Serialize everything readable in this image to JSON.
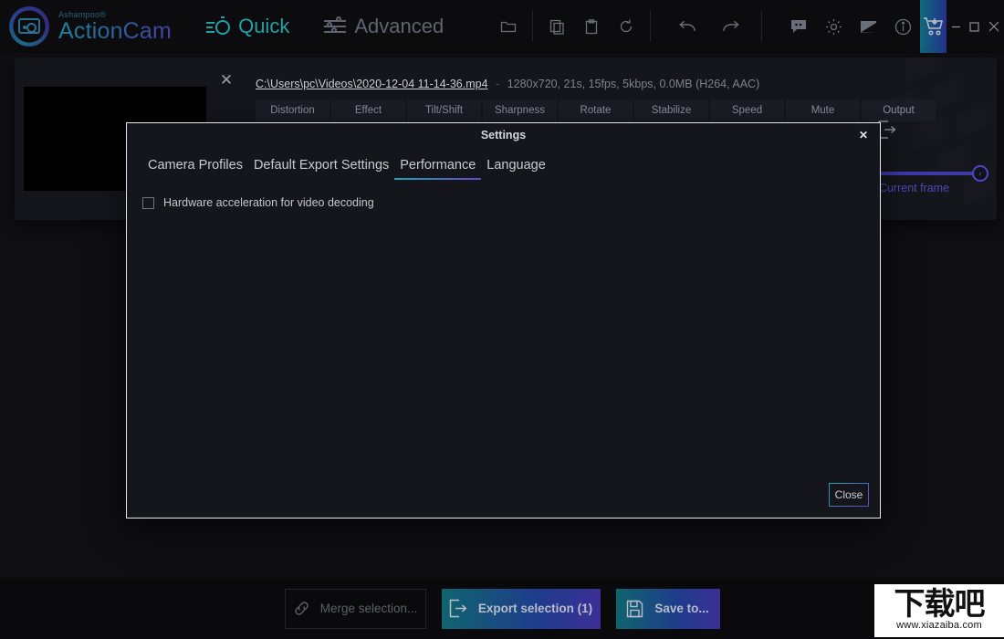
{
  "app": {
    "brand_sup": "Ashampoo®",
    "brand_name": "ActionCam",
    "accent_teal": "#1ba6b0",
    "accent_purple": "#6b43c9"
  },
  "titlebar": {
    "modes": [
      {
        "label": "Quick",
        "icon": "stopwatch-icon",
        "active": true
      },
      {
        "label": "Advanced",
        "icon": "sliders-icon",
        "active": false
      }
    ],
    "tools": [
      {
        "name": "open-folder-icon"
      },
      {
        "name": "copy-icon"
      },
      {
        "name": "paste-icon"
      },
      {
        "name": "reset-icon"
      },
      {
        "name": "undo-icon"
      },
      {
        "name": "redo-icon"
      },
      {
        "name": "feedback-icon"
      },
      {
        "name": "settings-gear-icon"
      },
      {
        "name": "theme-icon"
      },
      {
        "name": "info-icon"
      }
    ],
    "buy_icon": "cart-download-icon",
    "window_controls": {
      "minimize": "–",
      "maximize": "□",
      "close": "✕"
    }
  },
  "clip": {
    "close_glyph": "✕",
    "path": "C:\\Users\\pc\\Videos\\2020-12-04 11-14-36.mp4",
    "dash": "-",
    "info": "1280x720, 21s, 15fps, 5kbps, 0.0MB (H264, AAC)",
    "edit_tabs": [
      "Distortion",
      "Effect",
      "Tilt/Shift",
      "Sharpness",
      "Rotate",
      "Stabilize",
      "Speed",
      "Mute",
      "Output"
    ],
    "slider": {
      "label": "Current frame",
      "value": 100,
      "knob_glyph": "‹"
    }
  },
  "bottombar": {
    "merge_label": "Merge selection...",
    "merge_icon": "link-icon",
    "export_label": "Export selection (1)",
    "export_icon": "export-arrow-icon",
    "save_label": "Save to...",
    "save_icon": "floppy-disk-icon"
  },
  "watermark": {
    "cn": "下载吧",
    "url": "www.xiazaiba.com"
  },
  "dialog": {
    "title": "Settings",
    "close_glyph": "✕",
    "tabs": [
      {
        "label": "Camera Profiles",
        "active": false
      },
      {
        "label": "Default Export Settings",
        "active": false
      },
      {
        "label": "Performance",
        "active": true
      },
      {
        "label": "Language",
        "active": false
      }
    ],
    "performance": {
      "checkbox_label": "Hardware acceleration for video decoding",
      "checked": false
    },
    "close_button": "Close"
  }
}
